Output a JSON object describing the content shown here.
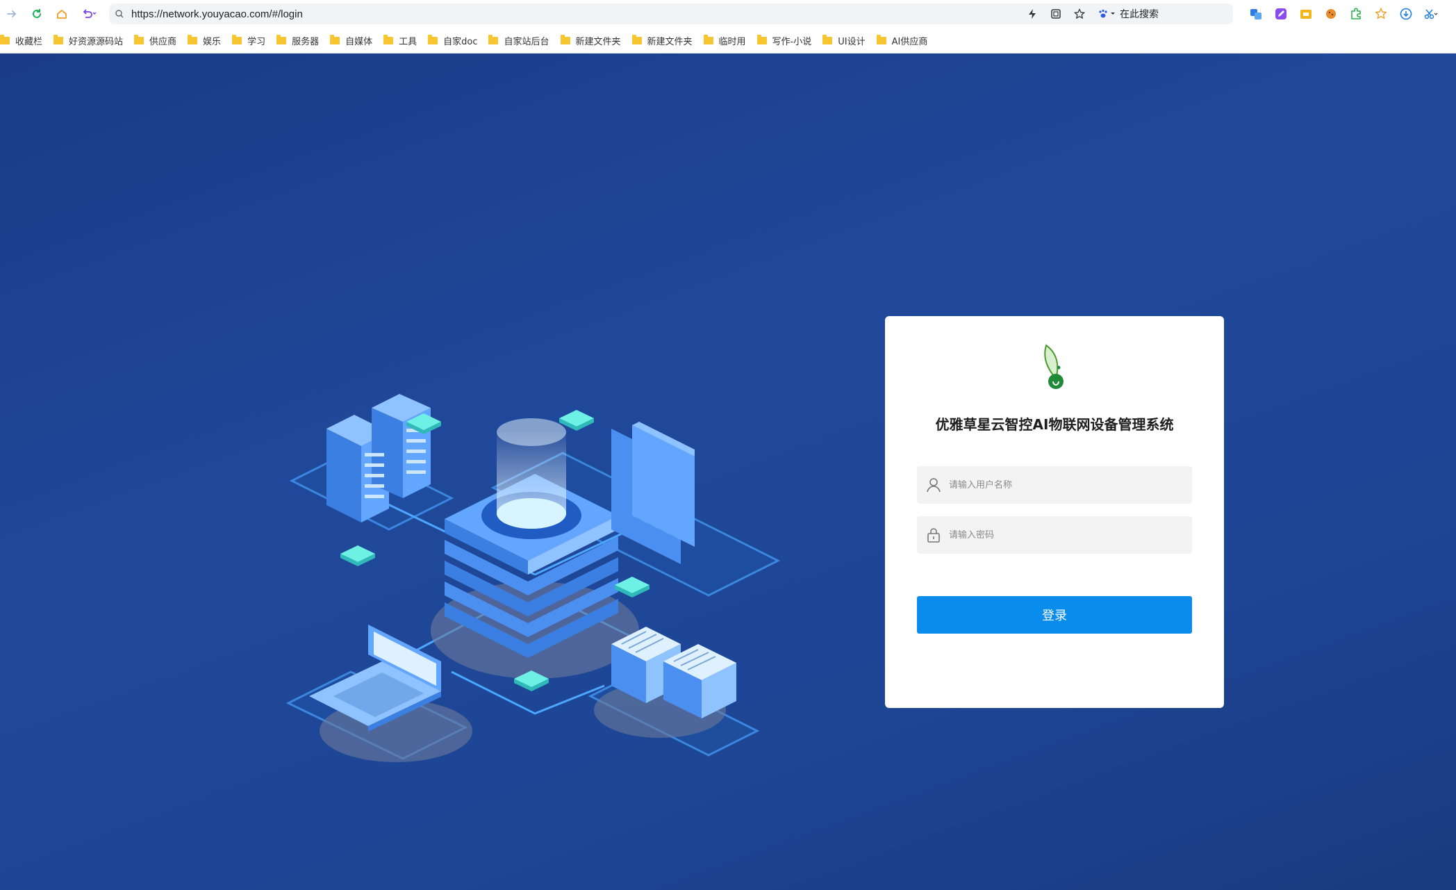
{
  "browser": {
    "url": "https://network.youyacao.com/#/login",
    "search_placeholder": "在此搜索",
    "bookmarks": [
      {
        "label": "收藏栏"
      },
      {
        "label": "好资源源码站"
      },
      {
        "label": "供应商"
      },
      {
        "label": "娱乐"
      },
      {
        "label": "学习"
      },
      {
        "label": "服务器"
      },
      {
        "label": "自媒体"
      },
      {
        "label": "工具"
      },
      {
        "label": "自家doc"
      },
      {
        "label": "自家站后台"
      },
      {
        "label": "新建文件夹"
      },
      {
        "label": "新建文件夹"
      },
      {
        "label": "临时用"
      },
      {
        "label": "写作-小说"
      },
      {
        "label": "UI设计"
      },
      {
        "label": "AI供应商"
      }
    ]
  },
  "login": {
    "title": "优雅草星云智控AI物联网设备管理系统",
    "username_placeholder": "请输入用户名称",
    "password_placeholder": "请输入密码",
    "submit_label": "登录"
  },
  "colors": {
    "background": "#1e4592",
    "primary_button": "#0a8cec",
    "card": "#ffffff"
  }
}
